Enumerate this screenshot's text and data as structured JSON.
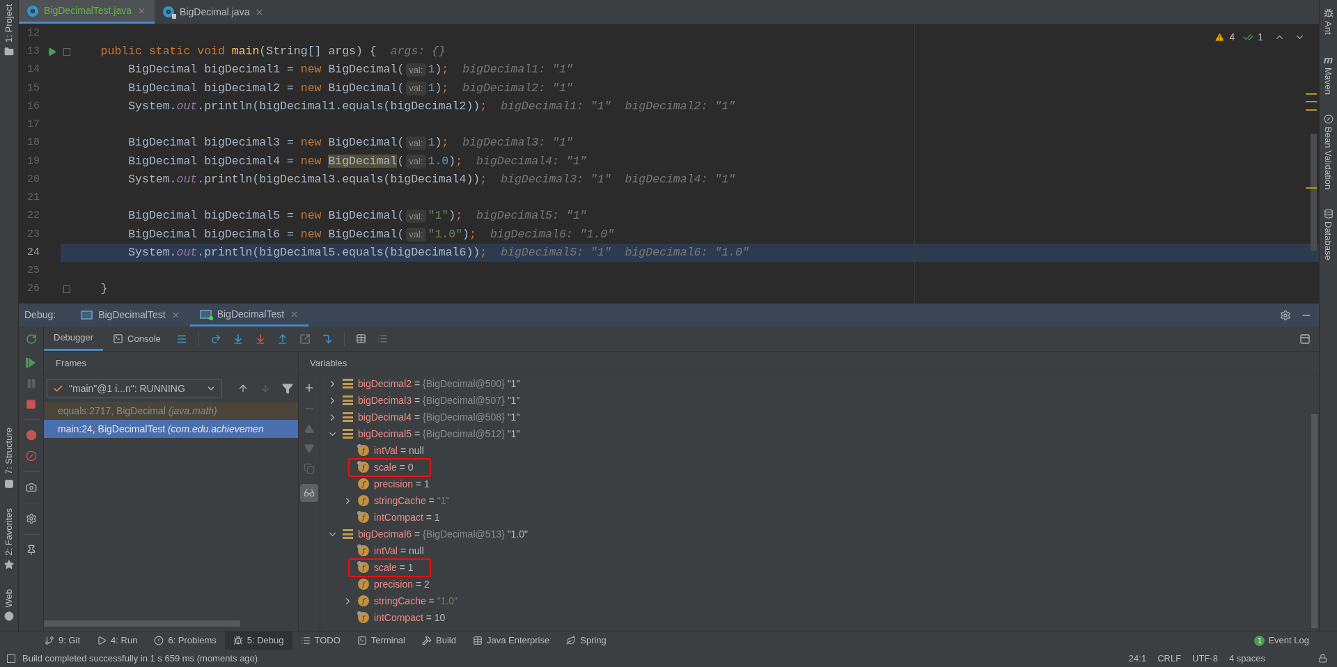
{
  "left_tool_strip": [
    {
      "label": "1: Project",
      "kind": "project"
    },
    {
      "label": "7: Structure",
      "kind": "structure"
    },
    {
      "label": "2: Favorites",
      "kind": "favorites"
    },
    {
      "label": "Web",
      "kind": "web"
    }
  ],
  "right_tool_strip": [
    {
      "label": "Ant",
      "kind": "ant"
    },
    {
      "label": "Maven",
      "kind": "maven",
      "glyph": "m"
    },
    {
      "label": "Bean Validation",
      "kind": "bean"
    },
    {
      "label": "Database",
      "kind": "database"
    }
  ],
  "editor": {
    "tabs": [
      {
        "label": "BigDecimalTest.java",
        "selected": true,
        "modified": true,
        "locked": false
      },
      {
        "label": "BigDecimal.java",
        "selected": false,
        "modified": false,
        "locked": true
      }
    ],
    "inspections": {
      "warnings": "4",
      "weak_warnings": "1"
    },
    "lines": [
      {
        "number": "12",
        "current": false,
        "run_marker": false,
        "fold_marker": false
      },
      {
        "number": "13",
        "current": false,
        "run_marker": true,
        "fold_marker": true,
        "tokens": [
          {
            "text": "    public static void ",
            "kind": "keyword"
          },
          {
            "text": "main",
            "kind": "method"
          },
          {
            "text": "(String[] args) {",
            "kind": "plain"
          },
          {
            "text": "args: {}",
            "kind": "hint"
          }
        ]
      },
      {
        "number": "14",
        "current": false,
        "run_marker": false,
        "fold_marker": false,
        "tokens": [
          {
            "text": "        BigDecimal bigDecimal1 = ",
            "kind": "plain"
          },
          {
            "text": "new",
            "kind": "keyword"
          },
          {
            "text": " BigDecimal(",
            "kind": "plain"
          },
          {
            "text": "val:",
            "kind": "param"
          },
          {
            "text": "1",
            "kind": "number"
          },
          {
            "text": ")",
            "kind": "plain"
          },
          {
            "text": ";",
            "kind": "keyword"
          },
          {
            "text": "bigDecimal1: \"1\"",
            "kind": "hint"
          }
        ]
      },
      {
        "number": "15",
        "current": false,
        "run_marker": false,
        "fold_marker": false,
        "tokens": [
          {
            "text": "        BigDecimal bigDecimal2 = ",
            "kind": "plain"
          },
          {
            "text": "new",
            "kind": "keyword"
          },
          {
            "text": " BigDecimal(",
            "kind": "plain"
          },
          {
            "text": "val:",
            "kind": "param"
          },
          {
            "text": "1",
            "kind": "number"
          },
          {
            "text": ")",
            "kind": "plain"
          },
          {
            "text": ";",
            "kind": "keyword"
          },
          {
            "text": "bigDecimal2: \"1\"",
            "kind": "hint"
          }
        ]
      },
      {
        "number": "16",
        "current": false,
        "run_marker": false,
        "fold_marker": false,
        "tokens": [
          {
            "text": "        System.",
            "kind": "plain"
          },
          {
            "text": "out",
            "kind": "field"
          },
          {
            "text": ".println(bigDecimal1.equals(bigDecimal2))",
            "kind": "plain"
          },
          {
            "text": ";",
            "kind": "keyword"
          },
          {
            "text": "bigDecimal1: \"1\"",
            "kind": "hint"
          },
          {
            "text": "bigDecimal2: \"1\"",
            "kind": "hint"
          }
        ]
      },
      {
        "number": "17",
        "current": false,
        "run_marker": false,
        "fold_marker": false
      },
      {
        "number": "18",
        "current": false,
        "run_marker": false,
        "fold_marker": false,
        "tokens": [
          {
            "text": "        BigDecimal bigDecimal3 = ",
            "kind": "plain"
          },
          {
            "text": "new",
            "kind": "keyword"
          },
          {
            "text": " BigDecimal(",
            "kind": "plain"
          },
          {
            "text": "val:",
            "kind": "param"
          },
          {
            "text": "1",
            "kind": "number"
          },
          {
            "text": ")",
            "kind": "plain"
          },
          {
            "text": ";",
            "kind": "keyword"
          },
          {
            "text": "bigDecimal3: \"1\"",
            "kind": "hint"
          }
        ]
      },
      {
        "number": "19",
        "current": false,
        "run_marker": false,
        "fold_marker": false,
        "tokens": [
          {
            "text": "        BigDecimal bigDecimal4 = ",
            "kind": "plain"
          },
          {
            "text": "new ",
            "kind": "keyword"
          },
          {
            "text": "BigDecimal",
            "kind": "match"
          },
          {
            "text": "(",
            "kind": "plain"
          },
          {
            "text": "val:",
            "kind": "param"
          },
          {
            "text": "1.0",
            "kind": "number"
          },
          {
            "text": ")",
            "kind": "plain"
          },
          {
            "text": ";",
            "kind": "keyword"
          },
          {
            "text": "bigDecimal4: \"1\"",
            "kind": "hint"
          }
        ]
      },
      {
        "number": "20",
        "current": false,
        "run_marker": false,
        "fold_marker": false,
        "tokens": [
          {
            "text": "        System.",
            "kind": "plain"
          },
          {
            "text": "out",
            "kind": "field"
          },
          {
            "text": ".println(bigDecimal3.equals(bigDecimal4))",
            "kind": "plain"
          },
          {
            "text": ";",
            "kind": "keyword"
          },
          {
            "text": "bigDecimal3: \"1\"",
            "kind": "hint"
          },
          {
            "text": "bigDecimal4: \"1\"",
            "kind": "hint"
          }
        ]
      },
      {
        "number": "21",
        "current": false,
        "run_marker": false,
        "fold_marker": false
      },
      {
        "number": "22",
        "current": false,
        "run_marker": false,
        "fold_marker": false,
        "tokens": [
          {
            "text": "        BigDecimal bigDecimal5 = ",
            "kind": "plain"
          },
          {
            "text": "new",
            "kind": "keyword"
          },
          {
            "text": " BigDecimal(",
            "kind": "plain"
          },
          {
            "text": "val:",
            "kind": "param"
          },
          {
            "text": "\"1\"",
            "kind": "string"
          },
          {
            "text": ")",
            "kind": "plain"
          },
          {
            "text": ";",
            "kind": "keyword"
          },
          {
            "text": "bigDecimal5: \"1\"",
            "kind": "hint"
          }
        ]
      },
      {
        "number": "23",
        "current": false,
        "run_marker": false,
        "fold_marker": false,
        "tokens": [
          {
            "text": "        BigDecimal bigDecimal6 = ",
            "kind": "plain"
          },
          {
            "text": "new",
            "kind": "keyword"
          },
          {
            "text": " BigDecimal(",
            "kind": "plain"
          },
          {
            "text": "val:",
            "kind": "param"
          },
          {
            "text": "\"1.0\"",
            "kind": "string"
          },
          {
            "text": ")",
            "kind": "plain"
          },
          {
            "text": ";",
            "kind": "keyword"
          },
          {
            "text": "bigDecimal6: \"1.0\"",
            "kind": "hint"
          }
        ]
      },
      {
        "number": "24",
        "current": true,
        "run_marker": false,
        "fold_marker": false,
        "tokens": [
          {
            "text": "        System.",
            "kind": "plain"
          },
          {
            "text": "out",
            "kind": "field"
          },
          {
            "text": ".println(bigDecimal5.equals(bigDecimal6))",
            "kind": "plain"
          },
          {
            "text": ";",
            "kind": "keyword"
          },
          {
            "text": "bigDecimal5: \"1\"",
            "kind": "hint"
          },
          {
            "text": "bigDecimal6: \"1.0\"",
            "kind": "hint"
          }
        ]
      },
      {
        "number": "25",
        "current": false,
        "run_marker": false,
        "fold_marker": false
      },
      {
        "number": "26",
        "current": false,
        "run_marker": false,
        "fold_marker": true,
        "tokens": [
          {
            "text": "    }",
            "kind": "plain"
          }
        ]
      }
    ]
  },
  "debug": {
    "label": "Debug:",
    "sessions": [
      {
        "label": "BigDecimalTest",
        "selected": false,
        "running": false
      },
      {
        "label": "BigDecimalTest",
        "selected": true,
        "running": true
      }
    ],
    "views": [
      {
        "label": "Debugger",
        "selected": true,
        "kind": "debugger"
      },
      {
        "label": "Console",
        "selected": false,
        "kind": "console"
      }
    ],
    "frames": {
      "title": "Frames",
      "thread": "\"main\"@1 i...n\": RUNNING",
      "items": [
        {
          "method": "equals:2717, BigDecimal",
          "package": "(java.math)",
          "selected": false,
          "library": true
        },
        {
          "method": "main:24, BigDecimalTest",
          "package": "(com.edu.achievemen",
          "selected": true,
          "library": false
        }
      ]
    },
    "variables": {
      "title": "Variables",
      "items": [
        {
          "kind": "object",
          "name": "bigDecimal2",
          "sign": "=",
          "ref": "{BigDecimal@500}",
          "value": "\"1\"",
          "expanded": false
        },
        {
          "kind": "object",
          "name": "bigDecimal3",
          "sign": "=",
          "ref": "{BigDecimal@507}",
          "value": "\"1\"",
          "expanded": false
        },
        {
          "kind": "object",
          "name": "bigDecimal4",
          "sign": "=",
          "ref": "{BigDecimal@508}",
          "value": "\"1\"",
          "expanded": false
        },
        {
          "kind": "object",
          "name": "bigDecimal5",
          "sign": "=",
          "ref": "{BigDecimal@512}",
          "value": "\"1\"",
          "expanded": true,
          "children": [
            {
              "kind": "field",
              "icon_letter": "f",
              "name": "intVal",
              "sign": "=",
              "value": "null",
              "final": true,
              "annotated": false
            },
            {
              "kind": "field",
              "icon_letter": "f",
              "name": "scale",
              "sign": "=",
              "value": "0",
              "final": true,
              "annotated": true
            },
            {
              "kind": "field",
              "icon_letter": "f",
              "name": "precision",
              "sign": "=",
              "value": "1",
              "final": false,
              "annotated": false
            },
            {
              "kind": "object_field",
              "icon_letter": "f",
              "name": "stringCache",
              "sign": "=",
              "value": "\"1\"",
              "final": false,
              "annotated": false,
              "expanded": false
            },
            {
              "kind": "field",
              "icon_letter": "f",
              "name": "intCompact",
              "sign": "=",
              "value": "1",
              "final": true,
              "annotated": false
            }
          ]
        },
        {
          "kind": "object",
          "name": "bigDecimal6",
          "sign": "=",
          "ref": "{BigDecimal@513}",
          "value": "\"1.0\"",
          "expanded": true,
          "children": [
            {
              "kind": "field",
              "icon_letter": "f",
              "name": "intVal",
              "sign": "=",
              "value": "null",
              "final": true,
              "annotated": false
            },
            {
              "kind": "field",
              "icon_letter": "f",
              "name": "scale",
              "sign": "=",
              "value": "1",
              "final": true,
              "annotated": true
            },
            {
              "kind": "field",
              "icon_letter": "f",
              "name": "precision",
              "sign": "=",
              "value": "2",
              "final": false,
              "annotated": false
            },
            {
              "kind": "object_field",
              "icon_letter": "f",
              "name": "stringCache",
              "sign": "=",
              "value": "\"1.0\"",
              "final": false,
              "annotated": false,
              "expanded": false
            },
            {
              "kind": "field",
              "icon_letter": "f",
              "name": "intCompact",
              "sign": "=",
              "value": "10",
              "final": true,
              "annotated": false
            }
          ]
        }
      ]
    }
  },
  "tool_windows": [
    {
      "label": "9: Git",
      "kind": "git",
      "selected": false
    },
    {
      "label": "4: Run",
      "kind": "run",
      "selected": false
    },
    {
      "label": "6: Problems",
      "kind": "problems",
      "selected": false
    },
    {
      "label": "5: Debug",
      "kind": "debug",
      "selected": true
    },
    {
      "label": "TODO",
      "kind": "todo",
      "selected": false
    },
    {
      "label": "Terminal",
      "kind": "terminal",
      "selected": false
    },
    {
      "label": "Build",
      "kind": "build",
      "selected": false
    },
    {
      "label": "Java Enterprise",
      "kind": "javaee",
      "selected": false
    },
    {
      "label": "Spring",
      "kind": "spring",
      "selected": false
    }
  ],
  "event_log": {
    "label": "Event Log",
    "count": "1"
  },
  "status_bar": {
    "message": "Build completed successfully in 1 s 659 ms (moments ago)",
    "position": "24:1",
    "line_separator": "CRLF",
    "encoding": "UTF-8",
    "indent": "4 spaces"
  }
}
